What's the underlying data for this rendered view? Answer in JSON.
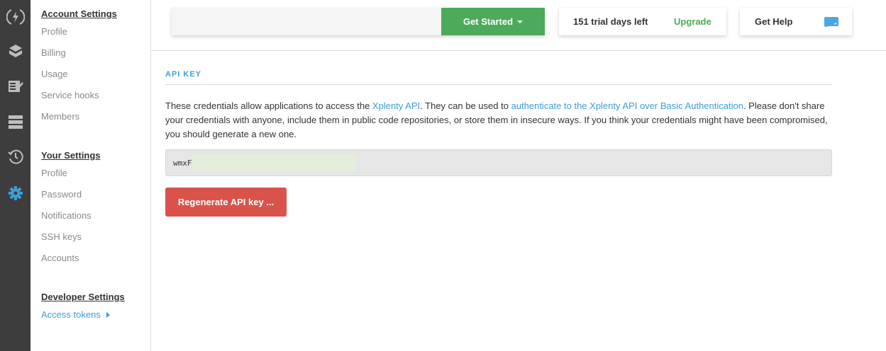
{
  "rail": {
    "icons": [
      "logo-bolt-icon",
      "packages-icon",
      "jobs-icon",
      "clusters-icon",
      "schedules-icon",
      "settings-gear-icon"
    ]
  },
  "sidebar": {
    "account": {
      "heading": "Account Settings",
      "items": [
        "Profile",
        "Billing",
        "Usage",
        "Service hooks",
        "Members"
      ]
    },
    "your": {
      "heading": "Your Settings",
      "items": [
        "Profile",
        "Password",
        "Notifications",
        "SSH keys",
        "Accounts"
      ]
    },
    "developer": {
      "heading": "Developer Settings",
      "items": [
        "Access tokens"
      ]
    }
  },
  "header": {
    "search_value": "",
    "get_started_label": "Get Started",
    "trial_text": "151 trial days left",
    "upgrade_label": "Upgrade",
    "help_label": "Get Help"
  },
  "main": {
    "section_title": "API KEY",
    "desc_part1": "These credentials allow applications to access the ",
    "desc_link1": "Xplenty API",
    "desc_part2": ". They can be used to ",
    "desc_link2": "authenticate to the Xplenty API over Basic Authentication",
    "desc_part3": ". Please don't share your credentials with anyone, include them in public code repositories, or store them in insecure ways. If you think your credentials might have been compromised, you should generate a new one.",
    "api_key_visible": "wmxF",
    "regenerate_label": "Regenerate API key ..."
  },
  "colors": {
    "accent_blue": "#3a9fd6",
    "green": "#4caa5a",
    "danger_red": "#d9534a",
    "rail_bg": "#3d3d3d"
  }
}
